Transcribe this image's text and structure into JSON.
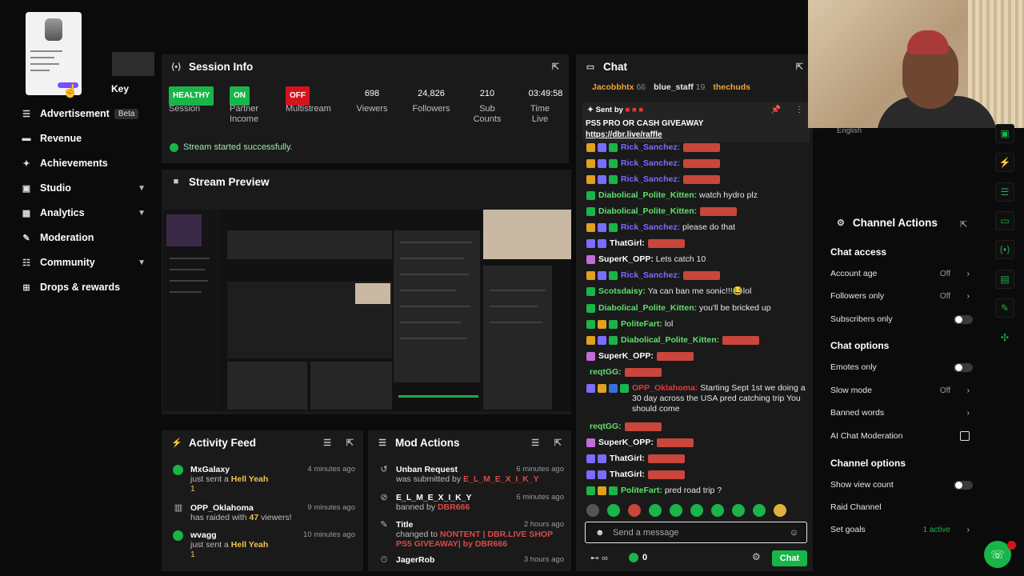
{
  "sidebar": {
    "key_label": "Key",
    "items": [
      {
        "label": "Advertisement",
        "badge": "Beta",
        "icon": "list-icon"
      },
      {
        "label": "Revenue",
        "icon": "revenue-icon"
      },
      {
        "label": "Achievements",
        "icon": "trophy-icon"
      },
      {
        "label": "Studio",
        "icon": "studio-icon",
        "expandable": true
      },
      {
        "label": "Analytics",
        "icon": "chart-icon",
        "expandable": true
      },
      {
        "label": "Moderation",
        "icon": "wrench-icon"
      },
      {
        "label": "Community",
        "icon": "community-icon",
        "expandable": true
      },
      {
        "label": "Drops & rewards",
        "icon": "gift-icon"
      }
    ]
  },
  "session": {
    "title": "Session Info",
    "stats": [
      {
        "value": "HEALTHY",
        "label": "Session",
        "style": "green"
      },
      {
        "value": "ON",
        "label": "Partner Income",
        "style": "green"
      },
      {
        "value": "OFF",
        "label": "Multistream",
        "style": "red"
      },
      {
        "value": "698",
        "label": "Viewers"
      },
      {
        "value": "24,826",
        "label": "Followers"
      },
      {
        "value": "210",
        "label": "Sub Counts"
      },
      {
        "value": "03:49:58",
        "label": "Time Live"
      }
    ],
    "status": "Stream started successfully."
  },
  "preview": {
    "title": "Stream Preview"
  },
  "chat": {
    "title": "Chat",
    "top_users": [
      {
        "name": "Jacobbhtx",
        "count": "66"
      },
      {
        "name": "blue_staff",
        "count": "19"
      },
      {
        "name": "thechuds",
        "count": ""
      }
    ],
    "pinned": {
      "sent_by": "Sent by",
      "text": "PS5 PRO OR CASH GIVEAWAY",
      "link": "https://dbr.live/raffle"
    },
    "messages": [
      {
        "user": "Rick_Sanchez:",
        "text": "",
        "color": "#7b6cff",
        "emote": true
      },
      {
        "user": "Rick_Sanchez:",
        "text": "",
        "color": "#7b6cff",
        "emote": true
      },
      {
        "user": "Rick_Sanchez:",
        "text": "",
        "color": "#7b6cff",
        "emote": true
      },
      {
        "user": "Diabolical_Polite_Kitten:",
        "text": "watch hydro plz",
        "color": "#5fe06b"
      },
      {
        "user": "Diabolical_Polite_Kitten:",
        "text": "",
        "color": "#5fe06b",
        "emote": true
      },
      {
        "user": "Rick_Sanchez:",
        "text": "please do that",
        "color": "#7b6cff"
      },
      {
        "user": "ThatGirl:",
        "text": "",
        "color": "#ffffff",
        "emote": true
      },
      {
        "user": "SuperK_OPP:",
        "text": "Lets catch 10",
        "color": "#ffffff"
      },
      {
        "user": "Rick_Sanchez:",
        "text": "",
        "color": "#7b6cff",
        "emote": true
      },
      {
        "user": "Scotsdaisy:",
        "text": "Ya can ban me sonic!!!😂lol",
        "color": "#5fe06b"
      },
      {
        "user": "Diabolical_Polite_Kitten:",
        "text": "you'll be bricked up",
        "color": "#5fe06b"
      },
      {
        "user": "PoliteFart:",
        "text": "lol",
        "color": "#5fe06b"
      },
      {
        "user": "Diabolical_Polite_Kitten:",
        "text": "",
        "color": "#5fe06b",
        "emote": true
      },
      {
        "user": "SuperK_OPP:",
        "text": "",
        "color": "#ffffff",
        "emote": true
      },
      {
        "user": "reqtGG:",
        "text": "",
        "color": "#5fe06b",
        "emote": true
      },
      {
        "user": "OPP_Oklahoma:",
        "text": "Starting Sept 1st we doing a 30 day across the USA pred catching trip You should come",
        "color": "#e03a3a"
      },
      {
        "user": "reqtGG:",
        "text": "",
        "color": "#5fe06b",
        "emote": true
      },
      {
        "user": "SuperK_OPP:",
        "text": "",
        "color": "#ffffff",
        "emote": true
      },
      {
        "user": "ThatGirl:",
        "text": "",
        "color": "#ffffff",
        "emote": true
      },
      {
        "user": "ThatGirl:",
        "text": "",
        "color": "#ffffff",
        "emote": true
      },
      {
        "user": "PoliteFart:",
        "text": "pred road trip ?",
        "color": "#5fe06b"
      }
    ],
    "input_placeholder": "Send a message",
    "points": "0",
    "send_label": "Chat"
  },
  "activity": {
    "title": "Activity Feed",
    "items": [
      {
        "name": "MxGalaxy",
        "action": "just sent a",
        "highlight": "Hell Yeah",
        "extra": "1",
        "time": "4 minutes ago"
      },
      {
        "name": "OPP_Oklahoma",
        "action": "has raided with",
        "highlight": "47",
        "extra": "viewers!",
        "time": "9 minutes ago"
      },
      {
        "name": "wvagg",
        "action": "just sent a",
        "highlight": "Hell Yeah",
        "extra": "1",
        "time": "10 minutes ago"
      }
    ]
  },
  "mod": {
    "title": "Mod Actions",
    "items": [
      {
        "name": "Unban Request",
        "action": "was submitted by",
        "by": "E_L_M_E_X_I_K_Y",
        "time": "6 minutes ago"
      },
      {
        "name": "E_L_M_E_X_I_K_Y",
        "action": "banned by",
        "by": "DBR666",
        "time": "6 minutes ago"
      },
      {
        "name": "Title",
        "action": "changed to",
        "by": "NONTENT | DBR.LIVE SHOP PS5 GIVEAWAY| by DBR666",
        "time": "2 hours ago"
      },
      {
        "name": "JagerRob",
        "action": "",
        "by": "",
        "time": "3 hours ago"
      }
    ]
  },
  "channel": {
    "title": "Channel Actions",
    "language": "English",
    "chat_access": "Chat access",
    "account_age": "Account age",
    "account_age_val": "Off",
    "followers_only": "Followers only",
    "followers_only_val": "Off",
    "subscribers_only": "Subscribers only",
    "chat_options": "Chat options",
    "emotes_only": "Emotes only",
    "slow_mode": "Slow mode",
    "slow_mode_val": "Off",
    "banned_words": "Banned words",
    "ai_mod": "AI Chat Moderation",
    "channel_options": "Channel options",
    "show_view_count": "Show view count",
    "raid_channel": "Raid Channel",
    "set_goals": "Set goals",
    "set_goals_val": "1 active"
  }
}
